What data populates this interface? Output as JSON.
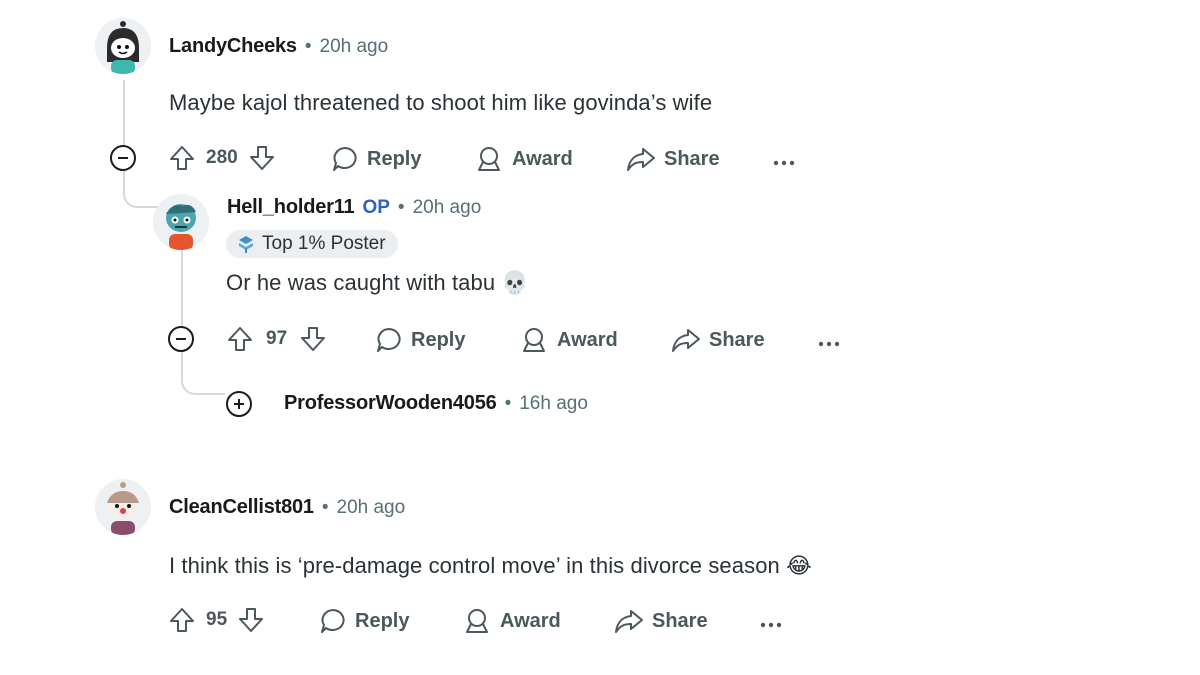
{
  "comments": [
    {
      "username": "LandyCheeks",
      "time": "20h ago",
      "body": "Maybe kajol threatened to shoot him like govinda’s wife",
      "score": "280",
      "reply_label": "Reply",
      "award_label": "Award",
      "share_label": "Share",
      "avatar_icon": "snoo-avatar-teal-hair"
    },
    {
      "username": "Hell_holder11",
      "op_badge": "OP",
      "time": "20h ago",
      "flair": "Top 1% Poster",
      "body": "Or he was caught with tabu 💀",
      "score": "97",
      "reply_label": "Reply",
      "award_label": "Award",
      "share_label": "Share",
      "avatar_icon": "snoo-avatar-zombie"
    },
    {
      "username": "ProfessorWooden4056",
      "time": "16h ago",
      "collapsed": true
    },
    {
      "username": "CleanCellist801",
      "time": "20h ago",
      "body": "I think this is ‘pre-damage control move’ in this divorce season 😂",
      "score": "95",
      "reply_label": "Reply",
      "award_label": "Award",
      "share_label": "Share",
      "avatar_icon": "snoo-avatar-clown"
    }
  ],
  "separator": "•",
  "colors": {
    "op": "#3461c1",
    "meta": "#576f76",
    "line": "#d4d9dc"
  }
}
